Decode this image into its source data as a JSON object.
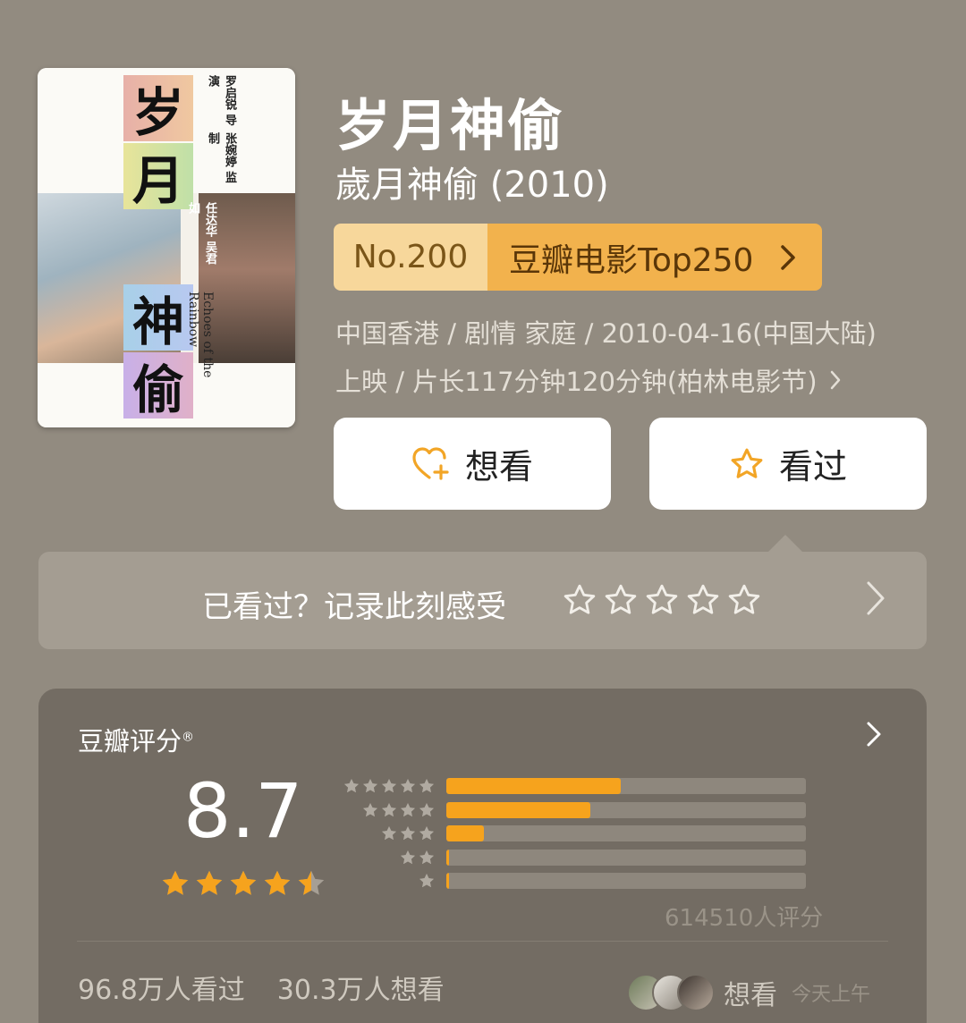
{
  "poster": {
    "chars": [
      "岁",
      "月",
      "神",
      "偷"
    ],
    "english_title": "Echoes of the Rainbow",
    "credits_director": "罗启锐 导演",
    "credits_producer": "张婉婷 监制",
    "credits_cast": "任达华 吴君如"
  },
  "movie": {
    "title": "岁月神偷",
    "original_title": "歲月神偷 (2010)",
    "rank_number": "No.200",
    "rank_list": "豆瓣电影Top250",
    "meta_line1": "中国香港 / 剧情 家庭 / 2010-04-16(中国大陆)",
    "meta_line2": "上映 / 片长117分钟120分钟(柏林电影节)"
  },
  "actions": {
    "want_label": "想看",
    "seen_label": "看过"
  },
  "rating_prompt": {
    "text": "已看过？记录此刻感受"
  },
  "score": {
    "label": "豆瓣评分",
    "registered": "®",
    "value": "8.7",
    "stars": 4.5,
    "distribution": [
      {
        "stars": 5,
        "percent": 48.5
      },
      {
        "stars": 4,
        "percent": 40.0
      },
      {
        "stars": 3,
        "percent": 10.5
      },
      {
        "stars": 2,
        "percent": 0.8
      },
      {
        "stars": 1,
        "percent": 0.2
      }
    ],
    "rating_count": "614510人评分",
    "watched": "96.8万人看过",
    "wanted": "30.3万人想看",
    "friend_action": "想看",
    "friend_time": "今天上午"
  },
  "colors": {
    "background": "#928b80",
    "accent_orange": "#f6a31d",
    "rank_light": "#f7d79b",
    "rank_dark": "#f2b24d"
  }
}
